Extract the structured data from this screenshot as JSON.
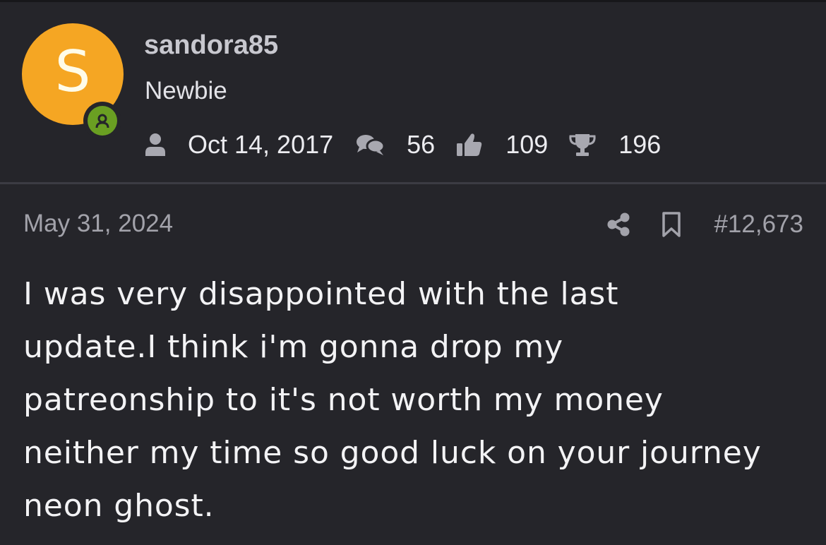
{
  "colors": {
    "background": "#25252a",
    "avatar": "#f5a623",
    "online_status": "#6a9f22",
    "muted_text": "#a2a2aa",
    "divider": "#3c3c43"
  },
  "author": {
    "avatar_letter": "S",
    "username": "sandora85",
    "title": "Newbie",
    "online_icon": "user-status-icon"
  },
  "stats": {
    "joined": "Oct 14, 2017",
    "messages": "56",
    "reactions": "109",
    "points": "196",
    "icons": {
      "joined": "user-icon",
      "messages": "chat-bubbles-icon",
      "reactions": "thumbs-up-icon",
      "points": "trophy-icon"
    }
  },
  "post": {
    "date": "May 31, 2024",
    "number": "#12,673",
    "share_icon": "share-icon",
    "bookmark_icon": "bookmark-icon",
    "body": "I was very disappointed with the last\nupdate.I think i'm gonna drop my\npatreonship to it's not worth my money\nneither my time so good luck on your journey\nneon ghost."
  }
}
